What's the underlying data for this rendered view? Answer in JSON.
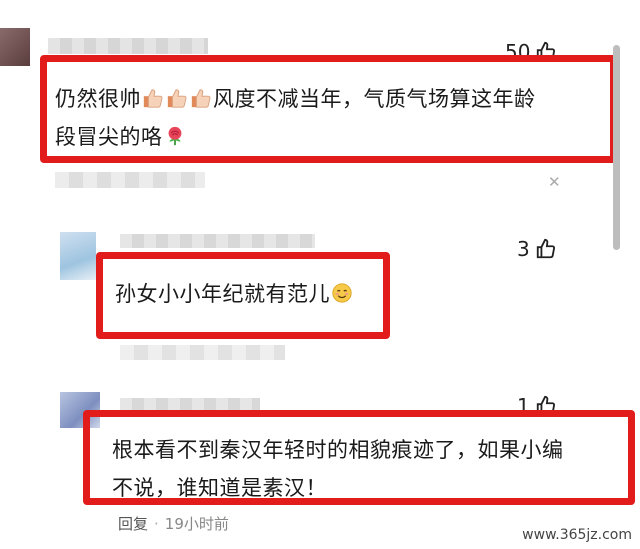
{
  "comments": [
    {
      "text_part1": "仍然很帅",
      "text_part2": "风度不减当年，气质气场算这年龄",
      "text_line2": "段冒尖的咯",
      "likes": "50",
      "emoji_names": [
        "thumbs-up-icon",
        "thumbs-up-icon",
        "thumbs-up-icon",
        "rose-icon"
      ]
    },
    {
      "text": "孙女小小年纪就有范儿",
      "likes": "3",
      "emoji_names": [
        "blush-icon"
      ]
    },
    {
      "text_line1": "根本看不到秦汉年轻时的相貌痕迹了，如果小编",
      "text_line2": "不说，谁知道是素汉！",
      "likes": "1"
    }
  ],
  "footer": {
    "reply_label": "回复",
    "separator": "·",
    "time": "19小时前"
  },
  "watermark": "www.365jz.com",
  "colors": {
    "highlight_box": "#e21b1b",
    "scrollbar": "#bdbdbd"
  }
}
